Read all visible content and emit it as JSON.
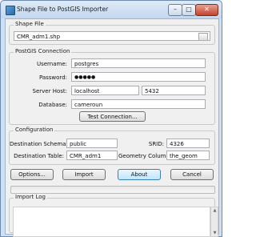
{
  "window": {
    "title": "Shape File to PostGIS Importer",
    "controls": {
      "minimize": "–",
      "maximize": "□",
      "close": "✕"
    }
  },
  "shape_file": {
    "legend": "Shape File",
    "value": "CMR_adm1.shp"
  },
  "connection": {
    "legend": "PostGIS Connection",
    "username_label": "Username:",
    "username": "postgres",
    "password_label": "Password:",
    "password": "●●●●●",
    "host_label": "Server Host:",
    "host": "localhost",
    "port": "5432",
    "database_label": "Database:",
    "database": "cameroun",
    "test_button": "Test Connection..."
  },
  "configuration": {
    "legend": "Configuration",
    "schema_label": "Destination Schema:",
    "schema": "public",
    "srid_label": "SRID:",
    "srid": "4326",
    "table_label": "Destination Table:",
    "table": "CMR_adm1",
    "geom_label": "Geometry Column:",
    "geom": "the_geom"
  },
  "actions": {
    "options": "Options...",
    "import": "Import",
    "about": "About",
    "cancel": "Cancel"
  },
  "log": {
    "legend": "Import Log"
  }
}
